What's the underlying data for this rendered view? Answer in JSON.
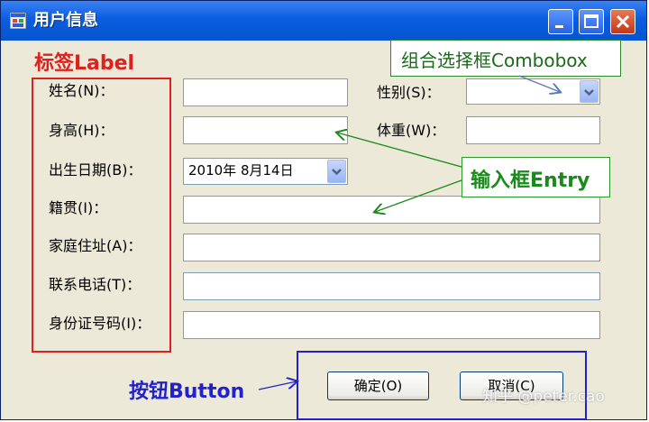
{
  "window": {
    "title": "用户信息"
  },
  "labels": {
    "name": "姓名(N)：",
    "height": "身高(H)：",
    "birth": "出生日期(B)：",
    "native": "籍贯(I)：",
    "address": "家庭住址(A)：",
    "phone": "联系电话(T)：",
    "idcard": "身份证号码(I)：",
    "gender": "性别(S)：",
    "weight": "体重(W)："
  },
  "fields": {
    "name": "",
    "height": "",
    "weight": "",
    "native": "",
    "address": "",
    "phone": "",
    "idcard": "",
    "gender": "",
    "birth": "2010年  8月14日"
  },
  "buttons": {
    "ok": "确定(O)",
    "cancel": "取消(C)"
  },
  "annotations": {
    "label": "标签Label",
    "combobox": "组合选择框Combobox",
    "entry": "输入框Entry",
    "button": "按钮Button"
  },
  "watermark": "知乎 @peter.cao",
  "colors": {
    "label_anno": "#e0201e",
    "entry_anno": "#1a8a1a",
    "button_anno": "#2222cc"
  }
}
